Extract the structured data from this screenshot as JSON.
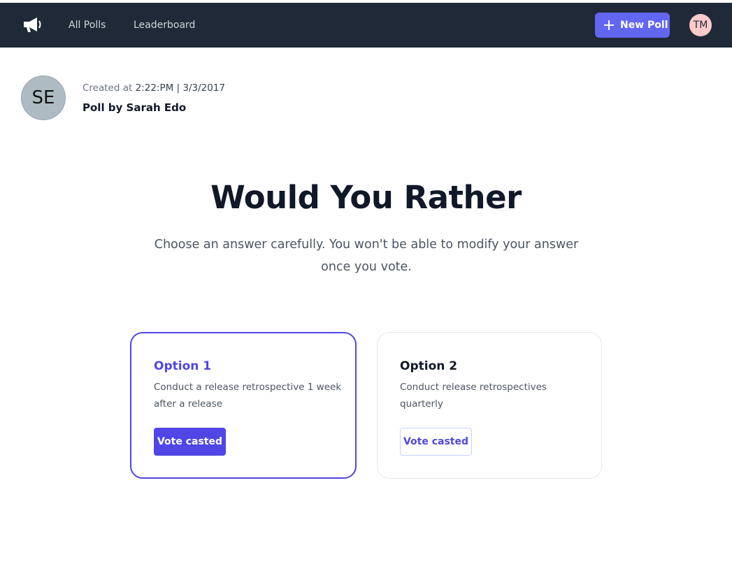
{
  "nav": {
    "logo_icon": "megaphone-icon",
    "links": [
      "All Polls",
      "Leaderboard"
    ],
    "new_poll_label": "New Poll",
    "user_initials": "TM"
  },
  "poll": {
    "author_initials": "SE",
    "created_label": "Created at",
    "created_time": "2:22:PM | 3/3/2017",
    "author_line": "Poll by Sarah Edo",
    "headline": "Would You Rather",
    "subtitle": "Choose an answer carefully. You won't be able to modify your answer once you vote."
  },
  "options": [
    {
      "title": "Option 1",
      "description": "Conduct a release retrospective 1 week after a release",
      "button_label": "Vote casted",
      "selected": true
    },
    {
      "title": "Option 2",
      "description": "Conduct release retrospectives quarterly",
      "button_label": "Vote casted",
      "selected": false
    }
  ],
  "colors": {
    "nav_bg": "#1f2937",
    "accent": "#4f46e5",
    "new_poll_bg": "#6366f1",
    "user_avatar_bg": "#fecaca",
    "author_avatar_bg": "#aebbc3"
  }
}
